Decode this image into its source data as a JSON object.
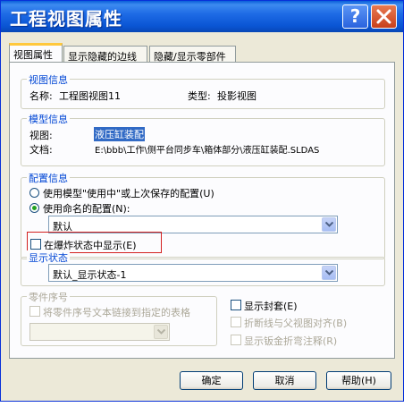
{
  "window": {
    "title": "工程视图属性",
    "help_glyph": "?"
  },
  "tabs": [
    "视图属性",
    "显示隐藏的边线",
    "隐藏/显示零部件"
  ],
  "view_info": {
    "title": "视图信息",
    "name_label": "名称:",
    "name_value": "工程图视图11",
    "type_label": "类型:",
    "type_value": "投影视图"
  },
  "model_info": {
    "title": "模型信息",
    "view_label": "视图:",
    "view_value": "液压缸装配",
    "doc_label": "文档:",
    "doc_value": "E:\\bbb\\工作\\侧平台同步车\\箱体部分\\液压缸装配.SLDAS"
  },
  "config": {
    "title": "配置信息",
    "option_use_model": "使用模型\"使用中\"或上次保存的配置(U)",
    "option_named": "使用命名的配置(N):",
    "named_value": "默认",
    "explode_label": "在爆炸状态中显示(E)"
  },
  "display_state": {
    "title": "显示状态",
    "value": "默认_显示状态-1"
  },
  "balloon": {
    "title": "零件序号",
    "link_label": "将零件序号文本链接到指定的表格",
    "table_value": ""
  },
  "options": {
    "show_envelope": "显示封套(E)",
    "align_break": "折断线与父视图对齐(B)",
    "sheet_metal_notes": "显示钣金折弯注释(R)"
  },
  "buttons": {
    "ok": "确定",
    "cancel": "取消",
    "help": "帮助(H)"
  },
  "colors": {
    "title_bar": "#0A55D4",
    "group_title": "#0046D5",
    "highlight_box": "#D32020",
    "selection": "#316AC5"
  }
}
